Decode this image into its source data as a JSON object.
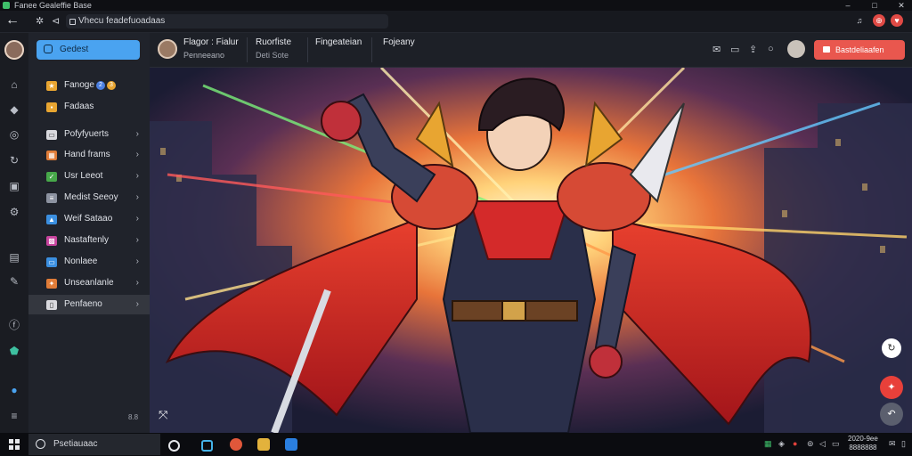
{
  "window": {
    "title": "Fanee Gealeffie Base",
    "controls": [
      "–",
      "□",
      "✕"
    ]
  },
  "address_bar": {
    "url_text": "Vhecu feadefuoadaas"
  },
  "sidebar": {
    "primary_button": "Gedest",
    "items": [
      {
        "label": "Fanoge",
        "icon_color": "#e8a531",
        "badges": [
          "2",
          "3"
        ]
      },
      {
        "label": "Fadaas",
        "icon_color": "#e8a531"
      },
      {
        "label": "Pofyfyuerts",
        "icon_color": "#d9d9de",
        "chevron": true
      },
      {
        "label": "Hand frams",
        "icon_color": "#e07c38",
        "chevron": true
      },
      {
        "label": "Usr Leeot",
        "icon_color": "#47a84a",
        "chevron": true
      },
      {
        "label": "Medist Seeoy",
        "icon_color": "#8c92a0",
        "chevron": true
      },
      {
        "label": "Weif Sataao",
        "icon_color": "#3b8fe0",
        "chevron": true
      },
      {
        "label": "Nastaftenly",
        "icon_color": "#c8449e",
        "chevron": true
      },
      {
        "label": "Nonlaee",
        "icon_color": "#3b8fe0",
        "chevron": true
      },
      {
        "label": "Unseanlanle",
        "icon_color": "#e07c38",
        "chevron": true
      },
      {
        "label": "Penfaeno",
        "icon_color": "#d9d9de",
        "chevron": true,
        "active": true
      }
    ],
    "version": "8.8"
  },
  "header": {
    "user_name": "Flagor : Fialur",
    "user_sub": "Penneeano",
    "tabs": [
      {
        "label": "Ruorfiste",
        "sub": "Deti Sote"
      },
      {
        "label": "Fingeateian",
        "sub": ""
      },
      {
        "label": "Fojeany",
        "sub": ""
      }
    ],
    "cta": "Bastdeliaafen"
  },
  "colors": {
    "accent": "#4aa3f0",
    "cta": "#e9574e",
    "sidebar_bg": "#20232b"
  },
  "taskbar": {
    "search_text": "Psetiauaac",
    "clock_time": "2020-9ee",
    "clock_date": "8888888"
  }
}
